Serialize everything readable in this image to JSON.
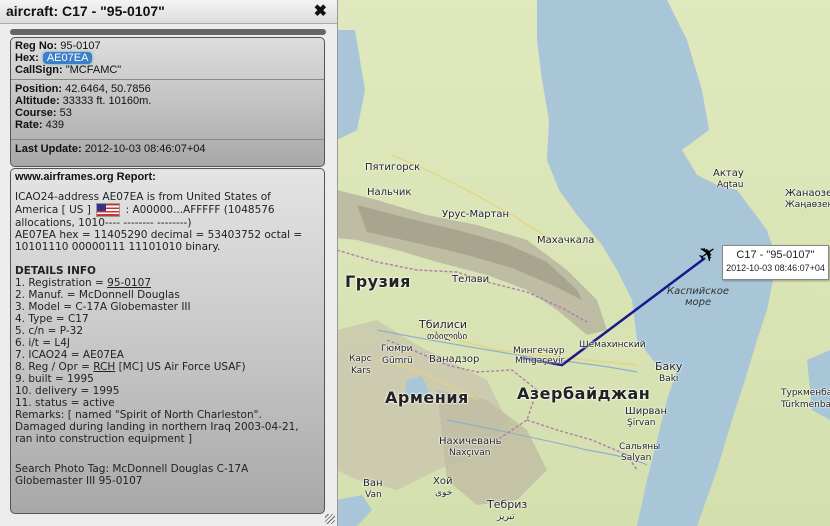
{
  "window": {
    "title": "aircraft: C17 - \"95-0107\"",
    "close_glyph": "✖"
  },
  "info": {
    "reg_label": "Reg No:",
    "reg": "95-0107",
    "hex_label": "Hex:",
    "hex": "AE07EA",
    "callsign_label": "CallSign:",
    "callsign": "\"MCFAMC\"",
    "position_label": "Position:",
    "position": "42.6464, 50.7856",
    "altitude_label": "Altitude:",
    "altitude": "33333 ft. 10160m.",
    "course_label": "Course:",
    "course": "53",
    "rate_label": "Rate:",
    "rate": "439",
    "last_update_label": "Last Update:",
    "last_update": "2012-10-03 08:46:07+04"
  },
  "report": {
    "title": "www.airframes.org Report:",
    "icao_line1": "ICAO24-address AE07EA is from United States of",
    "icao_line2a": "America [ US ]",
    "icao_line2b": ": A00000...AFFFFF (1048576",
    "icao_line3": "allocations, 1010---- -------- --------)",
    "hex_line1": "AE07EA hex = 11405290 decimal = 53403752 octal =",
    "hex_line2": "10101110 00000111 11101010 binary.",
    "details_title": "DETAILS INFO",
    "details": [
      "1. Registration = ",
      "2. Manuf. = McDonnell Douglas",
      "3. Model = C-17A Globemaster III",
      "4. Type = C17",
      "5. c/n = P-32",
      "6. i/t = L4J",
      "7. ICAO24 = AE07EA",
      "8. Reg / Opr = ",
      "9. built = 1995",
      "10. delivery = 1995",
      "11. status = active"
    ],
    "registration_link": "95-0107",
    "opr_link": "RCH",
    "opr_rest": " [MC] US Air Force USAF)",
    "remarks1": "Remarks: [ named \"Spirit of North Charleston\".",
    "remarks2": "Damaged during landing in northern Iraq 2003-04-21,",
    "remarks3": "ran into construction equipment ]",
    "photo1": "Search Photo Tag: McDonnell Douglas C-17A",
    "photo2": "Globemaster III 95-0107"
  },
  "map": {
    "flight_label_name": "C17 - \"95-0107\"",
    "flight_label_time": "2012-10-03 08:46:07+04",
    "labels": {
      "pyatigorsk": "Пятигорск",
      "nalchik": "Нальчик",
      "urus_martan": "Урус-Мартан",
      "makhachkala": "Махачкала",
      "gruziya": "Грузия",
      "telavi": "Телави",
      "tbilisi": "Тбилиси",
      "tbilisi_ka": "თბილისი",
      "mingechaur": "Мингечаур",
      "mingechaur_az": "Mingəçevir",
      "shemakhinsky": "Шемахинский",
      "baku": "Баку",
      "baku_az": "Bakı",
      "kars": "Карс",
      "kars_tr": "Kars",
      "gyumri": "Гюмри",
      "gyumri_am": "Gümrü",
      "vanadzor": "Ванадзор",
      "armeniya": "Армения",
      "azerbaijan": "Азербайджан",
      "shirvan": "Ширван",
      "shirvan_az": "Şirvan",
      "salyany": "Сальяны",
      "salyany_az": "Salyan",
      "nakhichevan": "Нахичевань",
      "nakhichevan_az": "Naxçıvan",
      "khoy": "Хой",
      "khoy_fa": "خوی",
      "van": "Ван",
      "van_tr": "Van",
      "tabriz": "Тебриз",
      "tabriz_fa": "تبریز",
      "caspian1": "Каспийское",
      "caspian2": "море",
      "aktau": "Актау",
      "aktau_kz": "Aqtau",
      "zhanaozen": "Жанаозен",
      "zhanaozen_kz": "Жаңаөзен",
      "turkmenbashi": "Туркменба",
      "turkmenbashi_tm": "Türkmenba"
    }
  },
  "colors": {
    "route": "#1a1a8c",
    "water": "#a8c6d8",
    "land": "#d9e6b4",
    "mountain": "#b9b7a2"
  }
}
